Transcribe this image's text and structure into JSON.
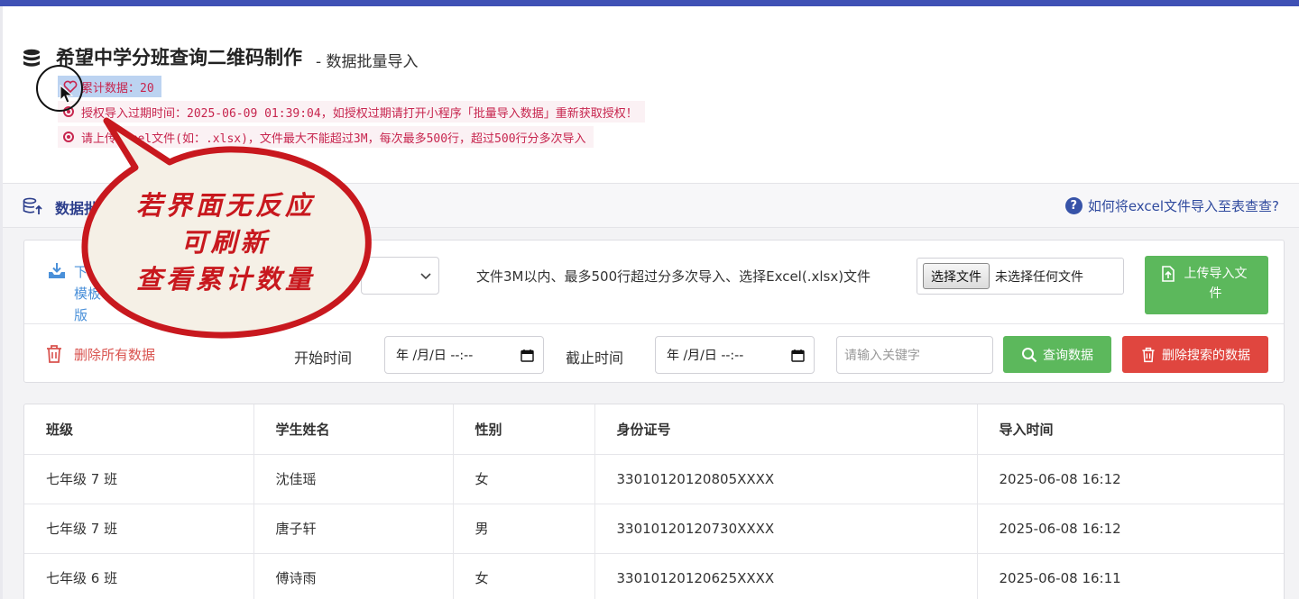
{
  "header": {
    "title": "希望中学分班查询二维码制作",
    "subtitle": "- 数据批量导入",
    "icon": "database-icon"
  },
  "notices": [
    {
      "text": "累计数据：20"
    },
    {
      "text": "授权导入过期时间：2025-06-09 01:39:04，如授权过期请打开小程序「批量导入数据」重新获取授权！"
    },
    {
      "text": "请上传excel文件(如：.xlsx)，文件最大不能超过3M，每次最多500行，超过500行分多次导入"
    }
  ],
  "section": {
    "title": "数据批量导入",
    "help_text": "如何将excel文件导入至表查查?",
    "help_icon": "question-circle-icon"
  },
  "upload": {
    "download_label": "下载模板版",
    "hint": "文件3M以内、最多500行超过分多次导入、选择Excel(.xlsx)文件",
    "file_button": "选择文件",
    "file_status": "未选择任何文件",
    "upload_button": "上传导入文件"
  },
  "filters": {
    "delete_all": "删除所有数据",
    "start_label": "开始时间",
    "end_label": "截止时间",
    "start_value": "年 /月/日 --:--",
    "end_value": "年 /月/日 --:--",
    "keyword_placeholder": "请输入关键字",
    "search_button": "查询数据",
    "delete_search_button": "删除搜索的数据"
  },
  "table": {
    "columns": [
      "班级",
      "学生姓名",
      "性别",
      "身份证号",
      "导入时间"
    ],
    "rows": [
      [
        "七年级 7 班",
        "沈佳瑶",
        "女",
        "33010120120805XXXX",
        "2025-06-08 16:12"
      ],
      [
        "七年级 7 班",
        "唐子轩",
        "男",
        "33010120120730XXXX",
        "2025-06-08 16:12"
      ],
      [
        "七年级 6 班",
        "傅诗雨",
        "女",
        "33010120120625XXXX",
        "2025-06-08 16:11"
      ]
    ]
  },
  "callout": {
    "lines": [
      "若界面无反应",
      "可刷新",
      "查看累计数量"
    ]
  },
  "colors": {
    "topbar": "#3f51b5",
    "notice_text": "#c7254e",
    "success": "#5cb85c",
    "danger": "#e0463f",
    "callout_red": "#c8181e",
    "callout_fill": "#f5f0e6"
  }
}
